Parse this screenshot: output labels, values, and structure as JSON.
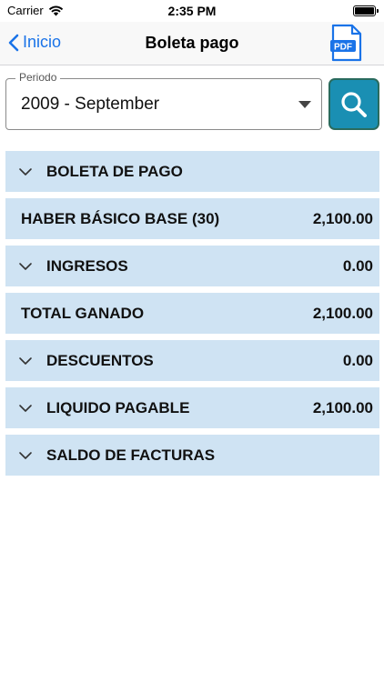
{
  "status": {
    "carrier": "Carrier",
    "time": "2:35 PM"
  },
  "nav": {
    "back_label": "Inicio",
    "title": "Boleta pago",
    "pdf_icon_text": "PDF"
  },
  "period": {
    "label": "Periodo",
    "value": "2009 - September"
  },
  "rows": [
    {
      "label": "BOLETA DE PAGO",
      "value": ""
    },
    {
      "label": "HABER BÁSICO BASE (30)",
      "value": "2,100.00"
    },
    {
      "label": "INGRESOS",
      "value": "0.00"
    },
    {
      "label": "TOTAL GANADO",
      "value": "2,100.00"
    },
    {
      "label": "DESCUENTOS",
      "value": "0.00"
    },
    {
      "label": "LIQUIDO PAGABLE",
      "value": "2,100.00"
    },
    {
      "label": "SALDO DE FACTURAS",
      "value": ""
    }
  ],
  "colors": {
    "accent": "#1a73e8",
    "row_bg": "#cfe3f3",
    "search_bg": "#1a8fb3"
  },
  "icons": [
    "wifi-icon",
    "battery-icon",
    "chevron-left-icon",
    "pdf-file-icon",
    "search-icon",
    "chevron-down-icon"
  ]
}
